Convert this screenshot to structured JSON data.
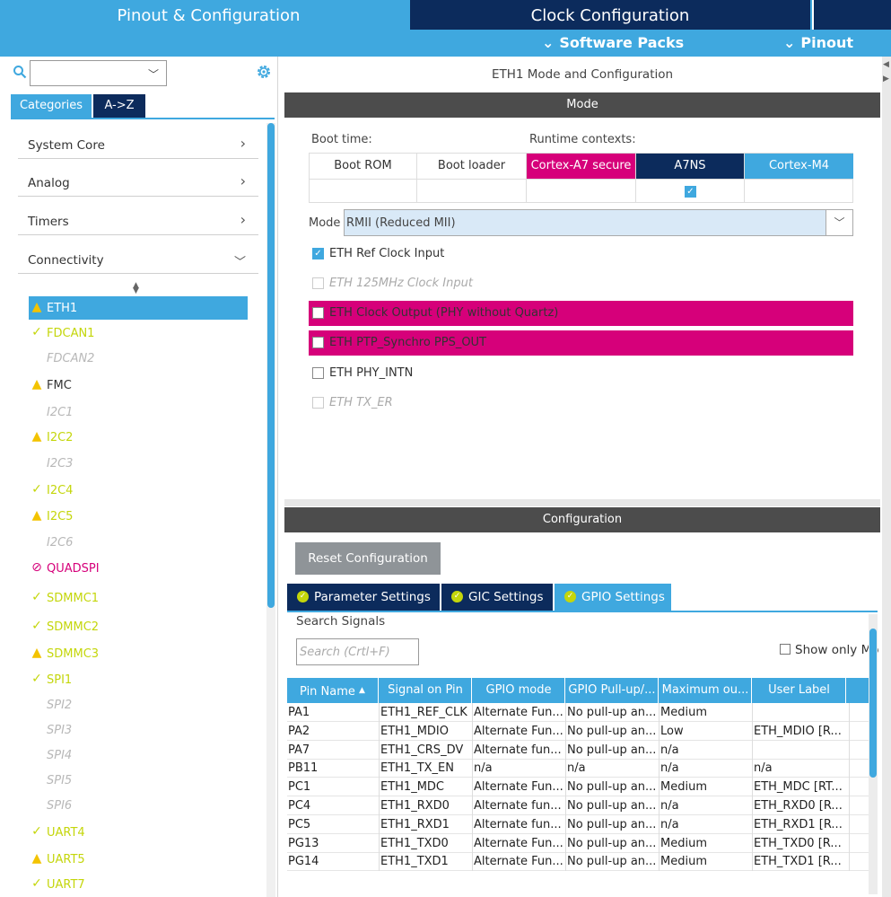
{
  "topbar": {
    "tab_pinout": "Pinout & Configuration",
    "tab_clock": "Clock Configuration",
    "software_packs": "Software Packs",
    "pinout_menu": "Pinout"
  },
  "sidebar": {
    "search_value": "",
    "tabs": [
      "Categories",
      "A->Z"
    ],
    "categories": [
      {
        "label": "System Core",
        "arrow": ">"
      },
      {
        "label": "Analog",
        "arrow": ">"
      },
      {
        "label": "Timers",
        "arrow": ">"
      },
      {
        "label": "Connectivity",
        "arrow": "v"
      }
    ],
    "peripherals": [
      {
        "name": "ETH1",
        "status": "warning",
        "selected": true
      },
      {
        "name": "FDCAN1",
        "status": "ok"
      },
      {
        "name": "FDCAN2",
        "status": "disabled"
      },
      {
        "name": "FMC",
        "status": "warning"
      },
      {
        "name": "I2C1",
        "status": "disabled"
      },
      {
        "name": "I2C2",
        "status": "warning"
      },
      {
        "name": "I2C3",
        "status": "disabled"
      },
      {
        "name": "I2C4",
        "status": "ok"
      },
      {
        "name": "I2C5",
        "status": "warning"
      },
      {
        "name": "I2C6",
        "status": "disabled"
      },
      {
        "name": "QUADSPI",
        "status": "error"
      },
      {
        "name": "SDMMC1",
        "status": "ok"
      },
      {
        "name": "SDMMC2",
        "status": "ok"
      },
      {
        "name": "SDMMC3",
        "status": "warning"
      },
      {
        "name": "SPI1",
        "status": "ok"
      },
      {
        "name": "SPI2",
        "status": "disabled"
      },
      {
        "name": "SPI3",
        "status": "disabled"
      },
      {
        "name": "SPI4",
        "status": "disabled"
      },
      {
        "name": "SPI5",
        "status": "disabled"
      },
      {
        "name": "SPI6",
        "status": "disabled"
      },
      {
        "name": "UART4",
        "status": "ok"
      },
      {
        "name": "UART5",
        "status": "warning"
      },
      {
        "name": "UART7",
        "status": "ok"
      }
    ]
  },
  "main": {
    "title": "ETH1 Mode and Configuration",
    "mode_bar": "Mode",
    "boot_time_label": "Boot time:",
    "runtime_label": "Runtime contexts:",
    "contexts": [
      "Boot ROM",
      "Boot loader",
      "Cortex-A7 secure",
      "A7NS",
      "Cortex-M4"
    ],
    "a7ns_checked": true,
    "mode_label": "Mode",
    "mode_value": "RMII (Reduced MII)",
    "options": [
      {
        "label": "ETH Ref Clock Input",
        "state": "checked"
      },
      {
        "label": "ETH 125MHz Clock Input",
        "state": "disabled"
      },
      {
        "label": "ETH Clock Output (PHY without Quartz)",
        "state": "conflict"
      },
      {
        "label": "ETH PTP_Synchro PPS_OUT",
        "state": "conflict"
      },
      {
        "label": "ETH PHY_INTN",
        "state": "unchecked"
      },
      {
        "label": "ETH TX_ER",
        "state": "disabled"
      }
    ],
    "config_bar": "Configuration",
    "reset_button": "Reset Configuration",
    "config_tabs": [
      "Parameter Settings",
      "GIC Settings",
      "GPIO Settings"
    ],
    "search_signals_label": "Search Signals",
    "search_placeholder": "Search (Crtl+F)",
    "show_only_label": "Show only Mo",
    "table": {
      "columns": [
        "Pin Name",
        "Signal on Pin",
        "GPIO mode",
        "GPIO Pull-up/...",
        "Maximum ou...",
        "User Label"
      ],
      "rows": [
        [
          "PA1",
          "ETH1_REF_CLK",
          "Alternate Fun...",
          "No pull-up an...",
          "Medium",
          ""
        ],
        [
          "PA2",
          "ETH1_MDIO",
          "Alternate Fun...",
          "No pull-up an...",
          "Low",
          "ETH_MDIO [R..."
        ],
        [
          "PA7",
          "ETH1_CRS_DV",
          "Alternate fun...",
          "No pull-up an...",
          "n/a",
          ""
        ],
        [
          "PB11",
          "ETH1_TX_EN",
          "n/a",
          "n/a",
          "n/a",
          "n/a"
        ],
        [
          "PC1",
          "ETH1_MDC",
          "Alternate Fun...",
          "No pull-up an...",
          "Medium",
          "ETH_MDC [RT..."
        ],
        [
          "PC4",
          "ETH1_RXD0",
          "Alternate fun...",
          "No pull-up an...",
          "n/a",
          "ETH_RXD0 [R..."
        ],
        [
          "PC5",
          "ETH1_RXD1",
          "Alternate fun...",
          "No pull-up an...",
          "n/a",
          "ETH_RXD1 [R..."
        ],
        [
          "PG13",
          "ETH1_TXD0",
          "Alternate Fun...",
          "No pull-up an...",
          "Medium",
          "ETH_TXD0 [R..."
        ],
        [
          "PG14",
          "ETH1_TXD1",
          "Alternate Fun...",
          "No pull-up an...",
          "Medium",
          "ETH_TXD1 [R..."
        ]
      ]
    }
  },
  "colors": {
    "accent": "#3fa8df",
    "navy": "#0c2b5c",
    "conflict": "#d6007a",
    "warning": "#f3c300",
    "ok": "#c4d60b",
    "bar": "#4c4c4c"
  }
}
